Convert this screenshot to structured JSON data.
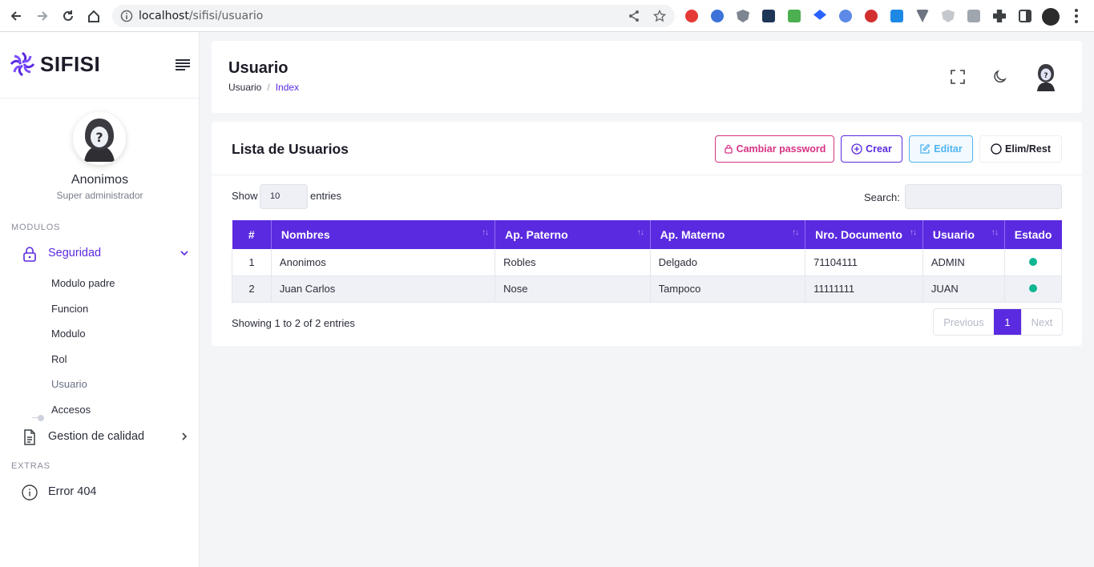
{
  "browser": {
    "url_host": "localhost",
    "url_path": "/sifisi/usuario"
  },
  "sidebar": {
    "brand": "SIFISI",
    "profile": {
      "name": "Anonimos",
      "role": "Super administrador"
    },
    "sections": {
      "modulos": "MODULOS",
      "extras": "EXTRAS"
    },
    "menu": {
      "seguridad": "Seguridad",
      "gestion": "Gestion de calidad",
      "error": "Error 404"
    },
    "submenu": [
      "Modulo padre",
      "Funcion",
      "Modulo",
      "Rol",
      "Usuario",
      "Accesos"
    ]
  },
  "header": {
    "title": "Usuario",
    "breadcrumb": [
      "Usuario",
      "Index"
    ]
  },
  "card": {
    "title": "Lista de Usuarios",
    "buttons": {
      "pwd": "Cambiar password",
      "crear": "Crear",
      "editar": "Editar",
      "elim": "Elim/Rest"
    },
    "length": {
      "show": "Show",
      "value": "10",
      "entries": "entries"
    },
    "search_label": "Search:",
    "columns": [
      "#",
      "Nombres",
      "Ap. Paterno",
      "Ap. Materno",
      "Nro. Documento",
      "Usuario",
      "Estado"
    ],
    "rows": [
      {
        "num": "1",
        "nombres": "Anonimos",
        "paterno": "Robles",
        "materno": "Delgado",
        "doc": "71104111",
        "usuario": "ADMIN",
        "estado": "active"
      },
      {
        "num": "2",
        "nombres": "Juan Carlos",
        "paterno": "Nose",
        "materno": "Tampoco",
        "doc": "11111111",
        "usuario": "JUAN",
        "estado": "active"
      }
    ],
    "info": "Showing 1 to 2 of 2 entries",
    "pagination": {
      "previous": "Previous",
      "page": "1",
      "next": "Next"
    }
  },
  "colors": {
    "accent": "#5a2ae0",
    "pink": "#d63384",
    "sky": "#4fb4ee",
    "status": "#10b592"
  }
}
